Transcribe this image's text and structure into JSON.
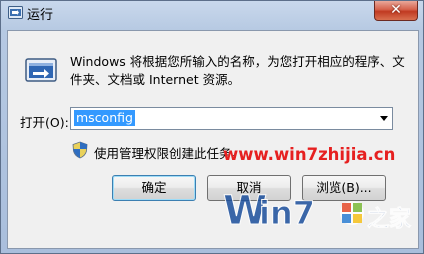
{
  "window": {
    "title": "运行",
    "close_glyph": "✕"
  },
  "dialog": {
    "description": "Windows 将根据您所输入的名称，为您打开相应的程序、文件夹、文档或 Internet 资源。",
    "open_label": "打开(O):",
    "command_value": "msconfig",
    "admin_note": "使用管理权限创建此任务。",
    "buttons": {
      "ok": "确定",
      "cancel": "取消",
      "browse": "浏览(B)..."
    }
  },
  "watermark": {
    "url": "www.win7zhijia.cn",
    "logo_text": "Win7之家"
  },
  "icons": {
    "app": "run-icon",
    "shield": "uac-shield-icon"
  },
  "colors": {
    "selection": "#3399ff",
    "watermark": "#e62020",
    "close": "#c03a21"
  }
}
